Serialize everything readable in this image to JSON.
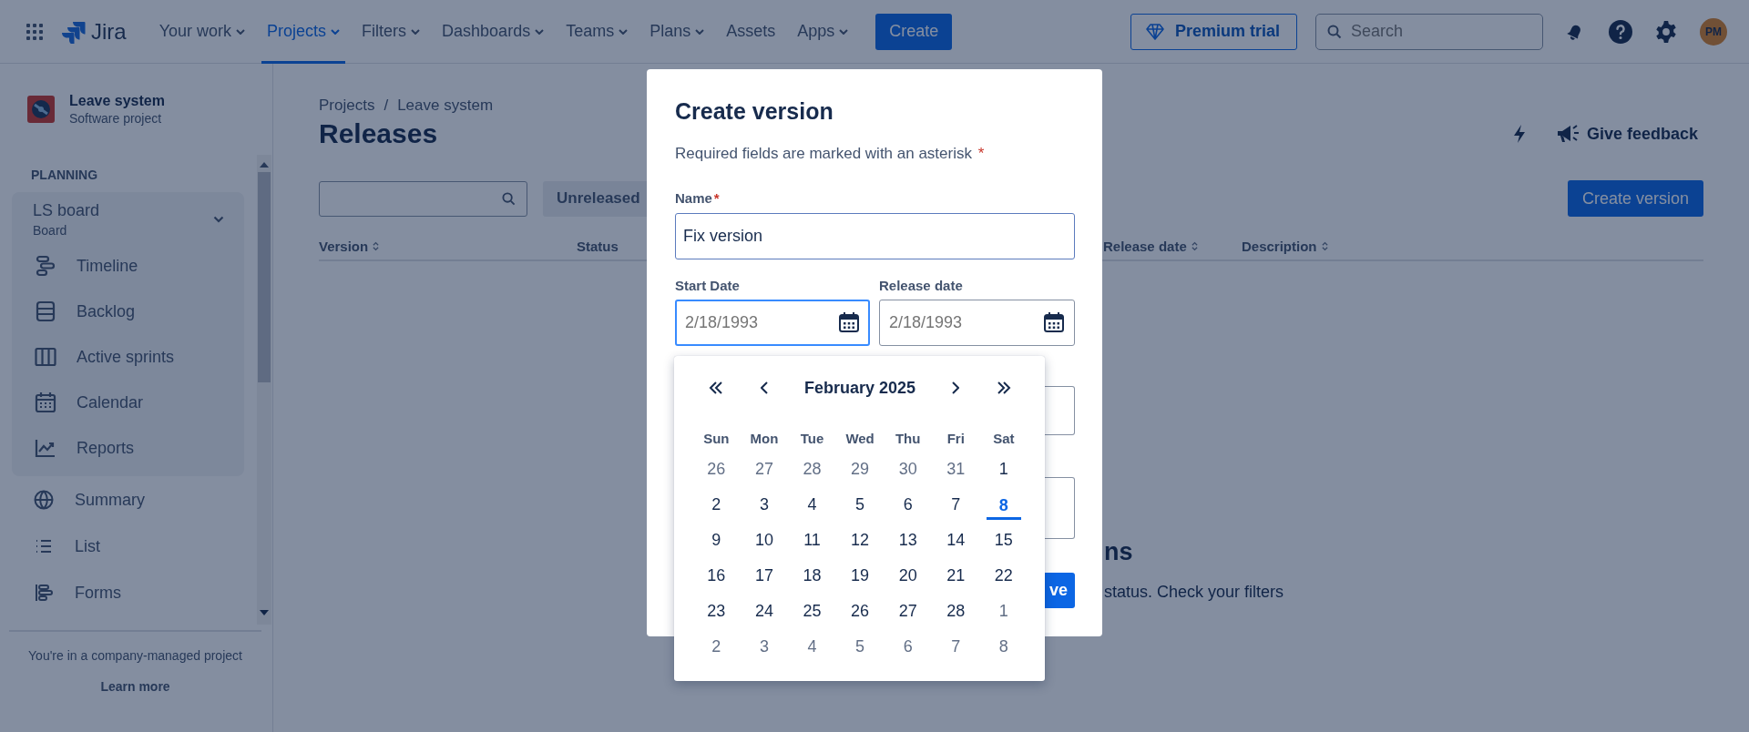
{
  "top_nav": {
    "brand": "Jira",
    "items": [
      {
        "label": "Your work",
        "dropdown": true,
        "selected": false
      },
      {
        "label": "Projects",
        "dropdown": true,
        "selected": true
      },
      {
        "label": "Filters",
        "dropdown": true,
        "selected": false
      },
      {
        "label": "Dashboards",
        "dropdown": true,
        "selected": false
      },
      {
        "label": "Teams",
        "dropdown": true,
        "selected": false
      },
      {
        "label": "Plans",
        "dropdown": true,
        "selected": false
      },
      {
        "label": "Assets",
        "dropdown": false,
        "selected": false
      },
      {
        "label": "Apps",
        "dropdown": true,
        "selected": false
      }
    ],
    "create_button": "Create",
    "premium_button": "Premium trial",
    "search": {
      "placeholder": "Search"
    },
    "avatar": "PM"
  },
  "sidebar": {
    "project": {
      "name": "Leave system",
      "type": "Software project"
    },
    "section_title": "PLANNING",
    "board": {
      "name": "LS board",
      "type": "Board",
      "expanded": true,
      "items": [
        {
          "label": "Timeline",
          "kind": "timeline"
        },
        {
          "label": "Backlog",
          "kind": "backlog"
        },
        {
          "label": "Active sprints",
          "kind": "sprints"
        },
        {
          "label": "Calendar",
          "kind": "calendar"
        },
        {
          "label": "Reports",
          "kind": "reports"
        }
      ]
    },
    "items": [
      {
        "label": "Summary",
        "kind": "globe"
      },
      {
        "label": "List",
        "kind": "list"
      },
      {
        "label": "Forms",
        "kind": "forms"
      }
    ],
    "footer_text": "You're in a company-managed project",
    "learn_more": "Learn more"
  },
  "main": {
    "breadcrumbs": [
      "Projects",
      "Leave system"
    ],
    "breadcrumb_separator": "/",
    "title": "Releases",
    "feedback_button": "Give feedback",
    "create_version_button": "Create version",
    "status_filter": "Unreleased",
    "columns": [
      {
        "label": "Version",
        "sortable": true
      },
      {
        "label": "Status",
        "sortable": false
      },
      {
        "label": "Release date",
        "sortable": true
      },
      {
        "label": "Description",
        "sortable": true
      }
    ],
    "empty_state": {
      "heading": "ns",
      "text": "status. Check your filters"
    }
  },
  "modal": {
    "title": "Create version",
    "required_note": "Required fields are marked with an asterisk",
    "required_note_mark": "*",
    "name": {
      "label": "Name",
      "required_mark": "*",
      "value": "Fix version"
    },
    "start_date": {
      "label": "Start Date",
      "placeholder": "2/18/1993",
      "focused": true
    },
    "release_date": {
      "label": "Release date",
      "placeholder": "2/18/1993",
      "focused": false
    },
    "save_button": "ve",
    "calendar": {
      "month": "February 2025",
      "weekdays": [
        "Sun",
        "Mon",
        "Tue",
        "Wed",
        "Thu",
        "Fri",
        "Sat"
      ],
      "days": [
        {
          "label": "26",
          "outside": true,
          "today": false
        },
        {
          "label": "27",
          "outside": true,
          "today": false
        },
        {
          "label": "28",
          "outside": true,
          "today": false
        },
        {
          "label": "29",
          "outside": true,
          "today": false
        },
        {
          "label": "30",
          "outside": true,
          "today": false
        },
        {
          "label": "31",
          "outside": true,
          "today": false
        },
        {
          "label": "1",
          "outside": false,
          "today": false
        },
        {
          "label": "2",
          "outside": false,
          "today": false
        },
        {
          "label": "3",
          "outside": false,
          "today": false
        },
        {
          "label": "4",
          "outside": false,
          "today": false
        },
        {
          "label": "5",
          "outside": false,
          "today": false
        },
        {
          "label": "6",
          "outside": false,
          "today": false
        },
        {
          "label": "7",
          "outside": false,
          "today": false
        },
        {
          "label": "8",
          "outside": false,
          "today": true
        },
        {
          "label": "9",
          "outside": false,
          "today": false
        },
        {
          "label": "10",
          "outside": false,
          "today": false
        },
        {
          "label": "11",
          "outside": false,
          "today": false
        },
        {
          "label": "12",
          "outside": false,
          "today": false
        },
        {
          "label": "13",
          "outside": false,
          "today": false
        },
        {
          "label": "14",
          "outside": false,
          "today": false
        },
        {
          "label": "15",
          "outside": false,
          "today": false
        },
        {
          "label": "16",
          "outside": false,
          "today": false
        },
        {
          "label": "17",
          "outside": false,
          "today": false
        },
        {
          "label": "18",
          "outside": false,
          "today": false
        },
        {
          "label": "19",
          "outside": false,
          "today": false
        },
        {
          "label": "20",
          "outside": false,
          "today": false
        },
        {
          "label": "21",
          "outside": false,
          "today": false
        },
        {
          "label": "22",
          "outside": false,
          "today": false
        },
        {
          "label": "23",
          "outside": false,
          "today": false
        },
        {
          "label": "24",
          "outside": false,
          "today": false
        },
        {
          "label": "25",
          "outside": false,
          "today": false
        },
        {
          "label": "26",
          "outside": false,
          "today": false
        },
        {
          "label": "27",
          "outside": false,
          "today": false
        },
        {
          "label": "28",
          "outside": false,
          "today": false
        },
        {
          "label": "1",
          "outside": true,
          "today": false
        },
        {
          "label": "2",
          "outside": true,
          "today": false
        },
        {
          "label": "3",
          "outside": true,
          "today": false
        },
        {
          "label": "4",
          "outside": true,
          "today": false
        },
        {
          "label": "5",
          "outside": true,
          "today": false
        },
        {
          "label": "6",
          "outside": true,
          "today": false
        },
        {
          "label": "7",
          "outside": true,
          "today": false
        },
        {
          "label": "8",
          "outside": true,
          "today": false
        }
      ]
    }
  }
}
